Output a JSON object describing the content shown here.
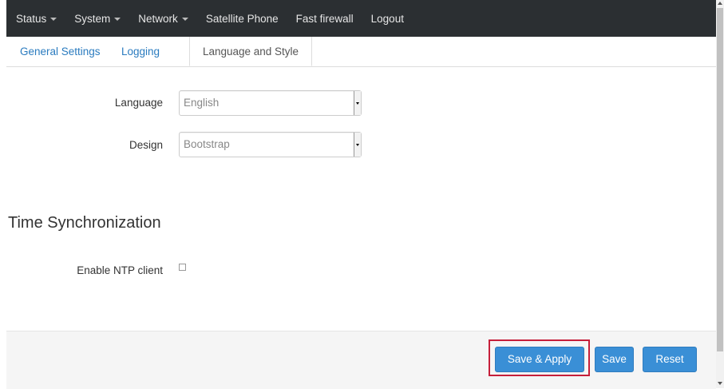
{
  "nav": {
    "items": [
      {
        "label": "Status",
        "dropdown": true
      },
      {
        "label": "System",
        "dropdown": true
      },
      {
        "label": "Network",
        "dropdown": true
      },
      {
        "label": "Satellite Phone",
        "dropdown": false
      },
      {
        "label": "Fast firewall",
        "dropdown": false
      },
      {
        "label": "Logout",
        "dropdown": false
      }
    ]
  },
  "tabs": {
    "general": "General Settings",
    "logging": "Logging",
    "language": "Language and Style",
    "active": "Language and Style"
  },
  "form": {
    "language_label": "Language",
    "language_value": "English",
    "design_label": "Design",
    "design_value": "Bootstrap"
  },
  "time_sync": {
    "title": "Time Synchronization",
    "ntp_label": "Enable NTP client",
    "ntp_checked": false
  },
  "footer": {
    "save_apply": "Save & Apply",
    "save": "Save",
    "reset": "Reset"
  },
  "colors": {
    "navbar_bg": "#2b2f32",
    "link": "#2a7bbf",
    "button": "#3a8fd6",
    "highlight": "#c61f3a"
  }
}
